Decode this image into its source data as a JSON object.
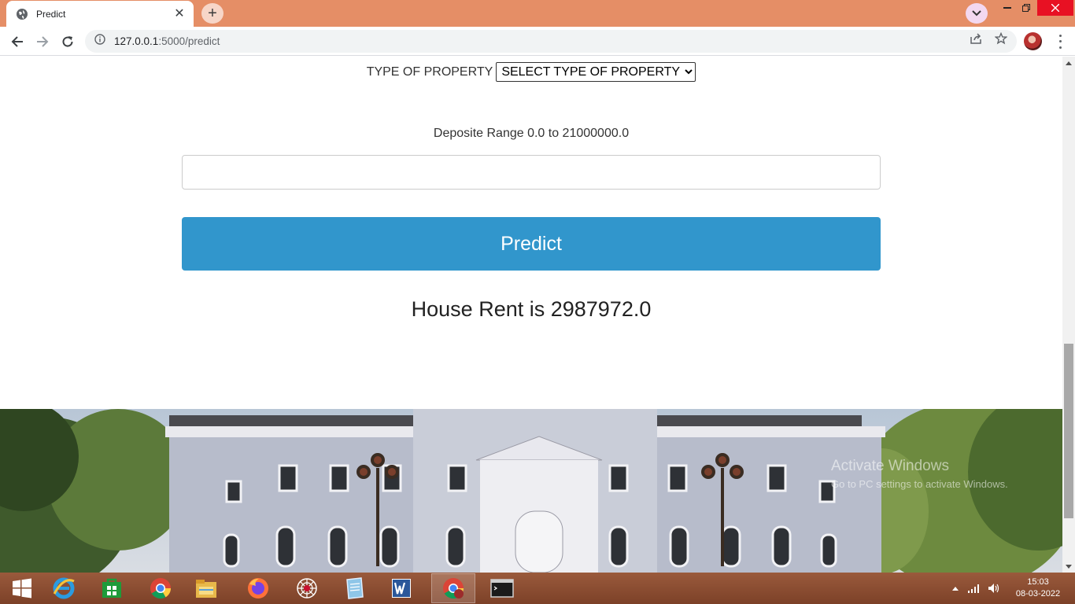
{
  "browser": {
    "tab_title": "Predict",
    "url_host": "127.0.0.1",
    "url_path": ":5000/predict",
    "tab_close_glyph": "✕",
    "new_tab_glyph": "+"
  },
  "form": {
    "type_label": "TYPE OF PROPERTY",
    "type_selected": "SELECT TYPE OF PROPERTY",
    "deposit_label": "Deposite Range 0.0 to 21000000.0",
    "deposit_value": "",
    "predict_label": "Predict"
  },
  "result": {
    "text": "House Rent is 2987972.0"
  },
  "watermark": {
    "line1": "Activate Windows",
    "line2": "Go to PC settings to activate Windows."
  },
  "taskbar": {
    "items": [
      "windows-start-icon",
      "internet-explorer-icon",
      "store-icon",
      "chrome-icon",
      "file-explorer-icon",
      "firefox-icon",
      "spider-app-icon",
      "notepad-icon",
      "word-icon",
      "chrome-active-icon",
      "terminal-icon"
    ],
    "time": "15:03",
    "date": "08-03-2022"
  },
  "colors": {
    "tabstrip": "#e58e66",
    "predict_button": "#3196cc",
    "taskbar": "#8a4b30"
  }
}
